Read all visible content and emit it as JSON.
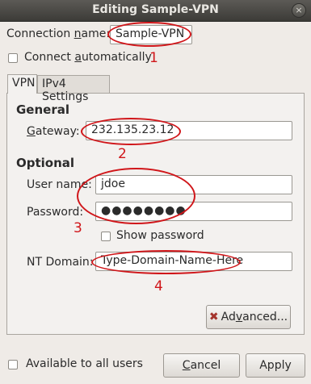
{
  "window": {
    "title": "Editing Sample-VPN",
    "close_icon": "×"
  },
  "connection_name": {
    "label_pre": "Connection ",
    "label_mnemonic": "n",
    "label_post": "ame:",
    "value": "Sample-VPN"
  },
  "connect_auto": {
    "label_pre": "Connect ",
    "label_mnemonic": "a",
    "label_post": "utomatically",
    "checked": false
  },
  "tabs": [
    {
      "label": "VPN",
      "selected": true
    },
    {
      "label": "IPv4 Settings",
      "selected": false
    }
  ],
  "general": {
    "heading": "General",
    "gateway_label_mnemonic": "G",
    "gateway_label_post": "ateway:",
    "gateway_value": "232.135.23.12"
  },
  "optional": {
    "heading": "Optional",
    "username_label": "User name:",
    "username_value": "jdoe",
    "password_label": "Password:",
    "password_value": "●●●●●●●●",
    "show_password_label": "Show password",
    "domain_label": "NT Domain:",
    "domain_value": "Type-Domain-Name-Here"
  },
  "buttons": {
    "advanced_pre": "Ad",
    "advanced_mnemonic": "v",
    "advanced_post": "anced...",
    "cancel_mnemonic": "C",
    "cancel_post": "ancel",
    "apply": "Apply"
  },
  "footer": {
    "available_label": "Available to all users"
  },
  "annotations": {
    "n1": "1",
    "n2": "2",
    "n3": "3",
    "n4": "4",
    "color": "#d0161a"
  }
}
